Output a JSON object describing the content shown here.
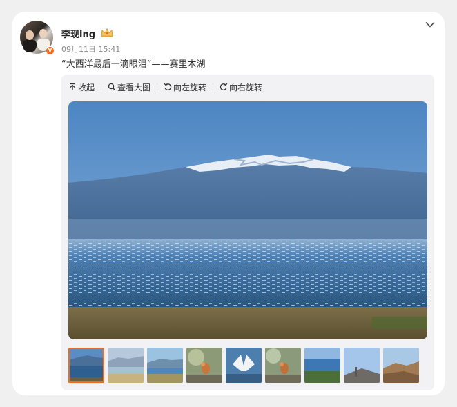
{
  "post": {
    "user": {
      "name": "李现ing",
      "verified_badge": "V",
      "crown_icon": "crown-icon"
    },
    "timestamp": "09月11日 15:41",
    "text": "“大西洋最后一滴眼泪”——赛里木湖"
  },
  "toolbar": {
    "collapse_label": "收起",
    "view_large_label": "查看大图",
    "rotate_left_label": "向左旋转",
    "rotate_right_label": "向右旋转"
  },
  "gallery": {
    "thumbnail_count": 9,
    "selected_index": 0
  },
  "colors": {
    "accent": "#f26b1d",
    "card_bg": "#ffffff",
    "page_bg": "#f0f0f0",
    "media_bg": "#f2f2f4"
  }
}
